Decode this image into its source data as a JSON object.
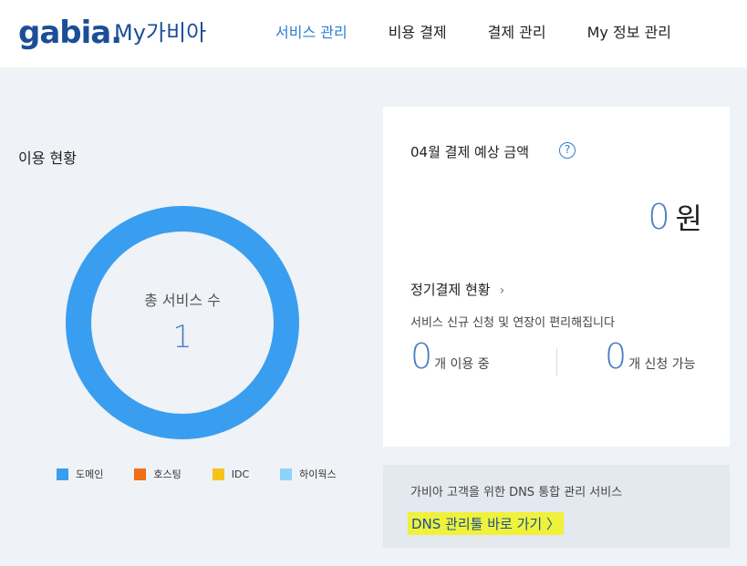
{
  "header": {
    "logo_text": "gabia.",
    "app_title": "My가비아",
    "nav": [
      {
        "label": "서비스 관리",
        "active": true
      },
      {
        "label": "비용 결제",
        "active": false
      },
      {
        "label": "결제 관리",
        "active": false
      },
      {
        "label": "My 정보 관리",
        "active": false
      }
    ]
  },
  "usage": {
    "title": "이용 현황",
    "total_label": "총 서비스 수",
    "total_value": "1",
    "legend": [
      {
        "label": "도메인",
        "color": "#3a9ef0"
      },
      {
        "label": "호스팅",
        "color": "#f07017"
      },
      {
        "label": "IDC",
        "color": "#f8c21c"
      },
      {
        "label": "하이웍스",
        "color": "#8dd3fa"
      }
    ]
  },
  "payment": {
    "title": "04월 결제 예상 금액",
    "help_icon": "question-circle-icon",
    "amount": "0",
    "amount_unit": "원",
    "recurring_title": "정기결제 현황",
    "recurring_desc": "서비스 신규 신청 및 연장이 편리해집니다",
    "in_use_count": "0",
    "in_use_label": "개 이용 중",
    "available_count": "0",
    "available_label": "개 신청 가능"
  },
  "dns": {
    "description": "가비아 고객을 위한 DNS 통합 관리 서비스",
    "link_label": "DNS 관리툴 바로 가기 〉"
  },
  "colors": {
    "brand": "#1a4e97",
    "accent": "#2b7fd0",
    "donut": "#3a9ef0",
    "highlight": "#f0f13a"
  }
}
